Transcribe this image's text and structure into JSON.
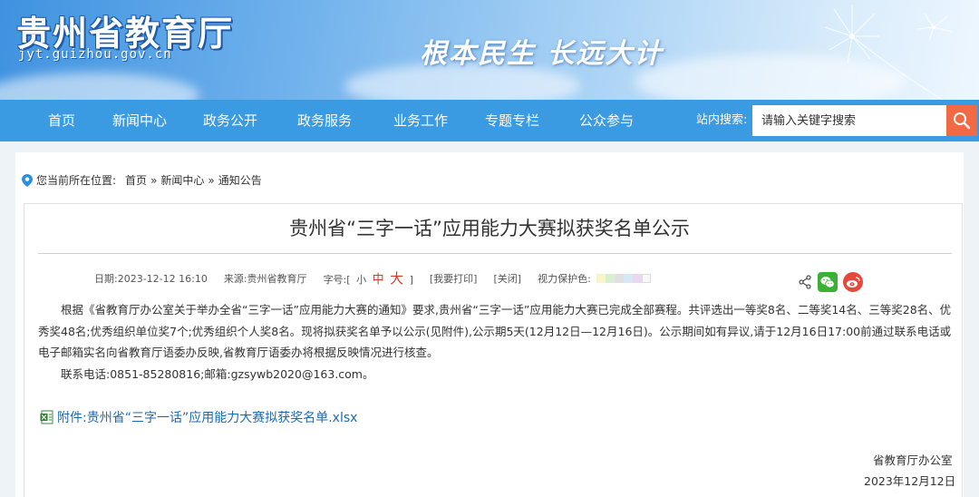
{
  "header": {
    "site_title": "贵州省教育厅",
    "site_domain": "jyt.guizhou.gov.cn",
    "slogan": "根本民生 长远大计"
  },
  "nav": {
    "items": [
      "首页",
      "新闻中心",
      "政务公开",
      "政务服务",
      "业务工作",
      "专题专栏",
      "公众参与"
    ],
    "search_label": "站内搜索:",
    "search_placeholder": "请输入关键字搜索"
  },
  "breadcrumb": {
    "prefix": "您当前所在位置:",
    "home": "首页",
    "sep1": "»",
    "news": "新闻中心",
    "sep2": "»",
    "notice": "通知公告"
  },
  "article": {
    "title": "贵州省“三字一话”应用能力大赛拟获奖名单公示",
    "date": "日期:2023-12-12 16:10",
    "source": "来源:贵州省教育厅",
    "font_label": "字号:[",
    "font_small": "小",
    "font_mid": "中",
    "font_big": "大",
    "font_end": "]",
    "print": "[我要打印]",
    "close": "[关闭]",
    "eye_label": "视力保护色:",
    "eye_colors": [
      "#f9f5c8",
      "#d9f0d0",
      "#e0e0e0",
      "#d6e8f5",
      "#ead8f2",
      "#f8f8f8"
    ],
    "para1": "根据《省教育厅办公室关于举办全省“三字一话”应用能力大赛的通知》要求,贵州省“三字一话”应用能力大赛已完成全部赛程。共评选出一等奖8名、二等奖14名、三等奖28名、优秀奖48名;优秀组织单位奖7个;优秀组织个人奖8名。现将拟获奖名单予以公示(见附件),公示期5天(12月12日—12月16日)。公示期间如有异议,请于12月16日17:00前通过联系电话或电子邮箱实名向省教育厅语委办反映,省教育厅语委办将根据反映情况进行核查。",
    "para2": "联系电话:0851-85280816;邮箱:gzsywb2020@163.com。",
    "attachment": "附件:贵州省“三字一话”应用能力大赛拟获奖名单.xlsx",
    "sign_org": "省教育厅办公室",
    "sign_date": "2023年12月12日"
  },
  "colors": {
    "nav_bg": "#3a9be3",
    "search_btn": "#f26a43",
    "link": "#1e6ab0"
  }
}
